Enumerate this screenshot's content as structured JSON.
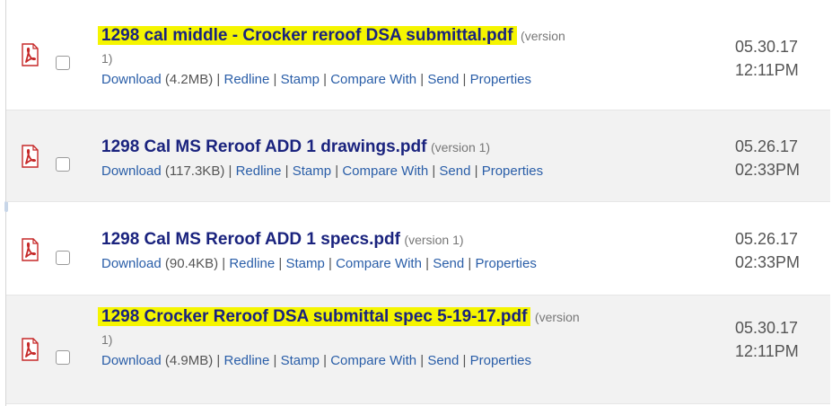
{
  "files": [
    {
      "name": "1298 cal middle - Crocker reroof DSA submittal.pdf",
      "version_label": "(version",
      "version_wrap": "1)",
      "download_label": "Download",
      "size": "(4.2MB)",
      "date": "05.30.17",
      "time": "12:11PM"
    },
    {
      "name": "1298 Cal MS Reroof ADD 1 drawings.pdf",
      "version_label": "(version 1)",
      "download_label": "Download",
      "size": "(117.3KB)",
      "date": "05.26.17",
      "time": "02:33PM"
    },
    {
      "name": "1298 Cal MS Reroof ADD 1 specs.pdf",
      "version_label": "(version 1)",
      "download_label": "Download",
      "size": "(90.4KB)",
      "date": "05.26.17",
      "time": "02:33PM"
    },
    {
      "name": "1298 Crocker Reroof DSA submittal spec 5-19-17.pdf",
      "version_label": "(version",
      "version_wrap": "1)",
      "download_label": "Download",
      "size": "(4.9MB)",
      "date": "05.30.17",
      "time": "12:11PM"
    }
  ],
  "actions": {
    "redline": "Redline",
    "stamp": "Stamp",
    "compare": "Compare With",
    "send": "Send",
    "properties": "Properties",
    "separator": "|"
  },
  "icons": {
    "file": "pdf-file-icon"
  },
  "colors": {
    "highlight": "#f5f500",
    "filename": "#1a237e",
    "link": "#2a5ea8",
    "row_alt": "#f2f2f2",
    "pdf_red": "#c62828"
  }
}
